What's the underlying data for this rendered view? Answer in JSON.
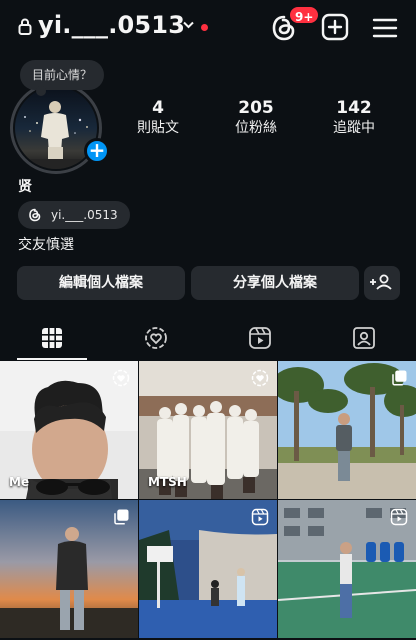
{
  "header": {
    "username": "yi.___.0513",
    "notification_badge": "9+",
    "icons": [
      "lock-icon",
      "chevron-down-icon",
      "threads-icon",
      "create-plus-icon",
      "menu-icon"
    ],
    "dot_color": "#ff3040"
  },
  "profile": {
    "note_prompt": "目前心情？",
    "display_name": "贤",
    "threads_handle": "yi.___.0513",
    "bio": "交友慎選",
    "stats": [
      {
        "value": "4",
        "label": "則貼文"
      },
      {
        "value": "205",
        "label": "位粉絲"
      },
      {
        "value": "142",
        "label": "追蹤中"
      }
    ]
  },
  "actions": {
    "edit_profile": "編輯個人檔案",
    "share_profile": "分享個人檔案"
  },
  "tabs": [
    "grid-icon",
    "collab-icon",
    "reels-icon",
    "tagged-icon"
  ],
  "grid": {
    "items": [
      {
        "caption": "Me",
        "overlay": "collab-icon"
      },
      {
        "caption": "MTSH",
        "overlay": "collab-icon"
      },
      {
        "caption": "",
        "overlay": "carousel-icon"
      },
      {
        "caption": "",
        "overlay": "carousel-icon"
      },
      {
        "caption": "",
        "overlay": "reel-icon"
      },
      {
        "caption": "",
        "overlay": "reel-icon"
      }
    ]
  },
  "colors": {
    "background": "#0c1014",
    "button": "#262a2f",
    "accent": "#0095f6",
    "badge": "#ff3040"
  }
}
